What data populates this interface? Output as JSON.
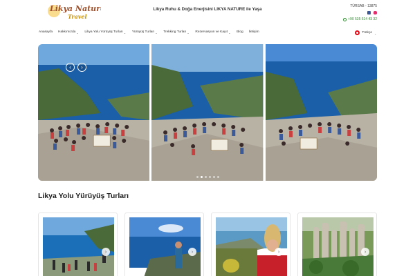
{
  "header": {
    "logo_text_line1": "Likya Nature",
    "logo_text_line2": "Travel",
    "tagline": "Likya Ruhu & Doğa Enerjisini LIKYA NATURE ile Yaşa",
    "tursab": "TÜRSAB - 13875",
    "phone": "+90 535 614 43 32"
  },
  "nav": {
    "items": [
      {
        "label": "Anasayfa",
        "has_dropdown": false
      },
      {
        "label": "Hakkımızda",
        "has_dropdown": true
      },
      {
        "label": "Likya Yolu Yürüyüş Turları",
        "has_dropdown": true
      },
      {
        "label": "Yürüyüş Turları",
        "has_dropdown": true
      },
      {
        "label": "Trekking Turları",
        "has_dropdown": true
      },
      {
        "label": "Rezervasyon ve Kayıt",
        "has_dropdown": true
      },
      {
        "label": "Blog",
        "has_dropdown": false
      },
      {
        "label": "İletişim",
        "has_dropdown": false
      }
    ],
    "language": "Türkçe"
  },
  "slider": {
    "prev_icon": "‹",
    "next_icon": "›",
    "slide_count": 6,
    "active_slide": 1
  },
  "section": {
    "title": "Likya Yolu Yürüyüş Turları"
  },
  "cards": [
    {
      "next_icon": "›"
    },
    {
      "next_icon": "›"
    },
    {
      "next_icon": "›"
    },
    {
      "next_icon": "›"
    }
  ],
  "colors": {
    "logo_gold": "#c8930a",
    "logo_text": "#a0522d",
    "sea": "#1a5fa8",
    "sky": "#6fa8dc",
    "rock": "#b8b2a4",
    "flag_red": "#e30a17",
    "whatsapp_green": "#2a8a2a"
  }
}
